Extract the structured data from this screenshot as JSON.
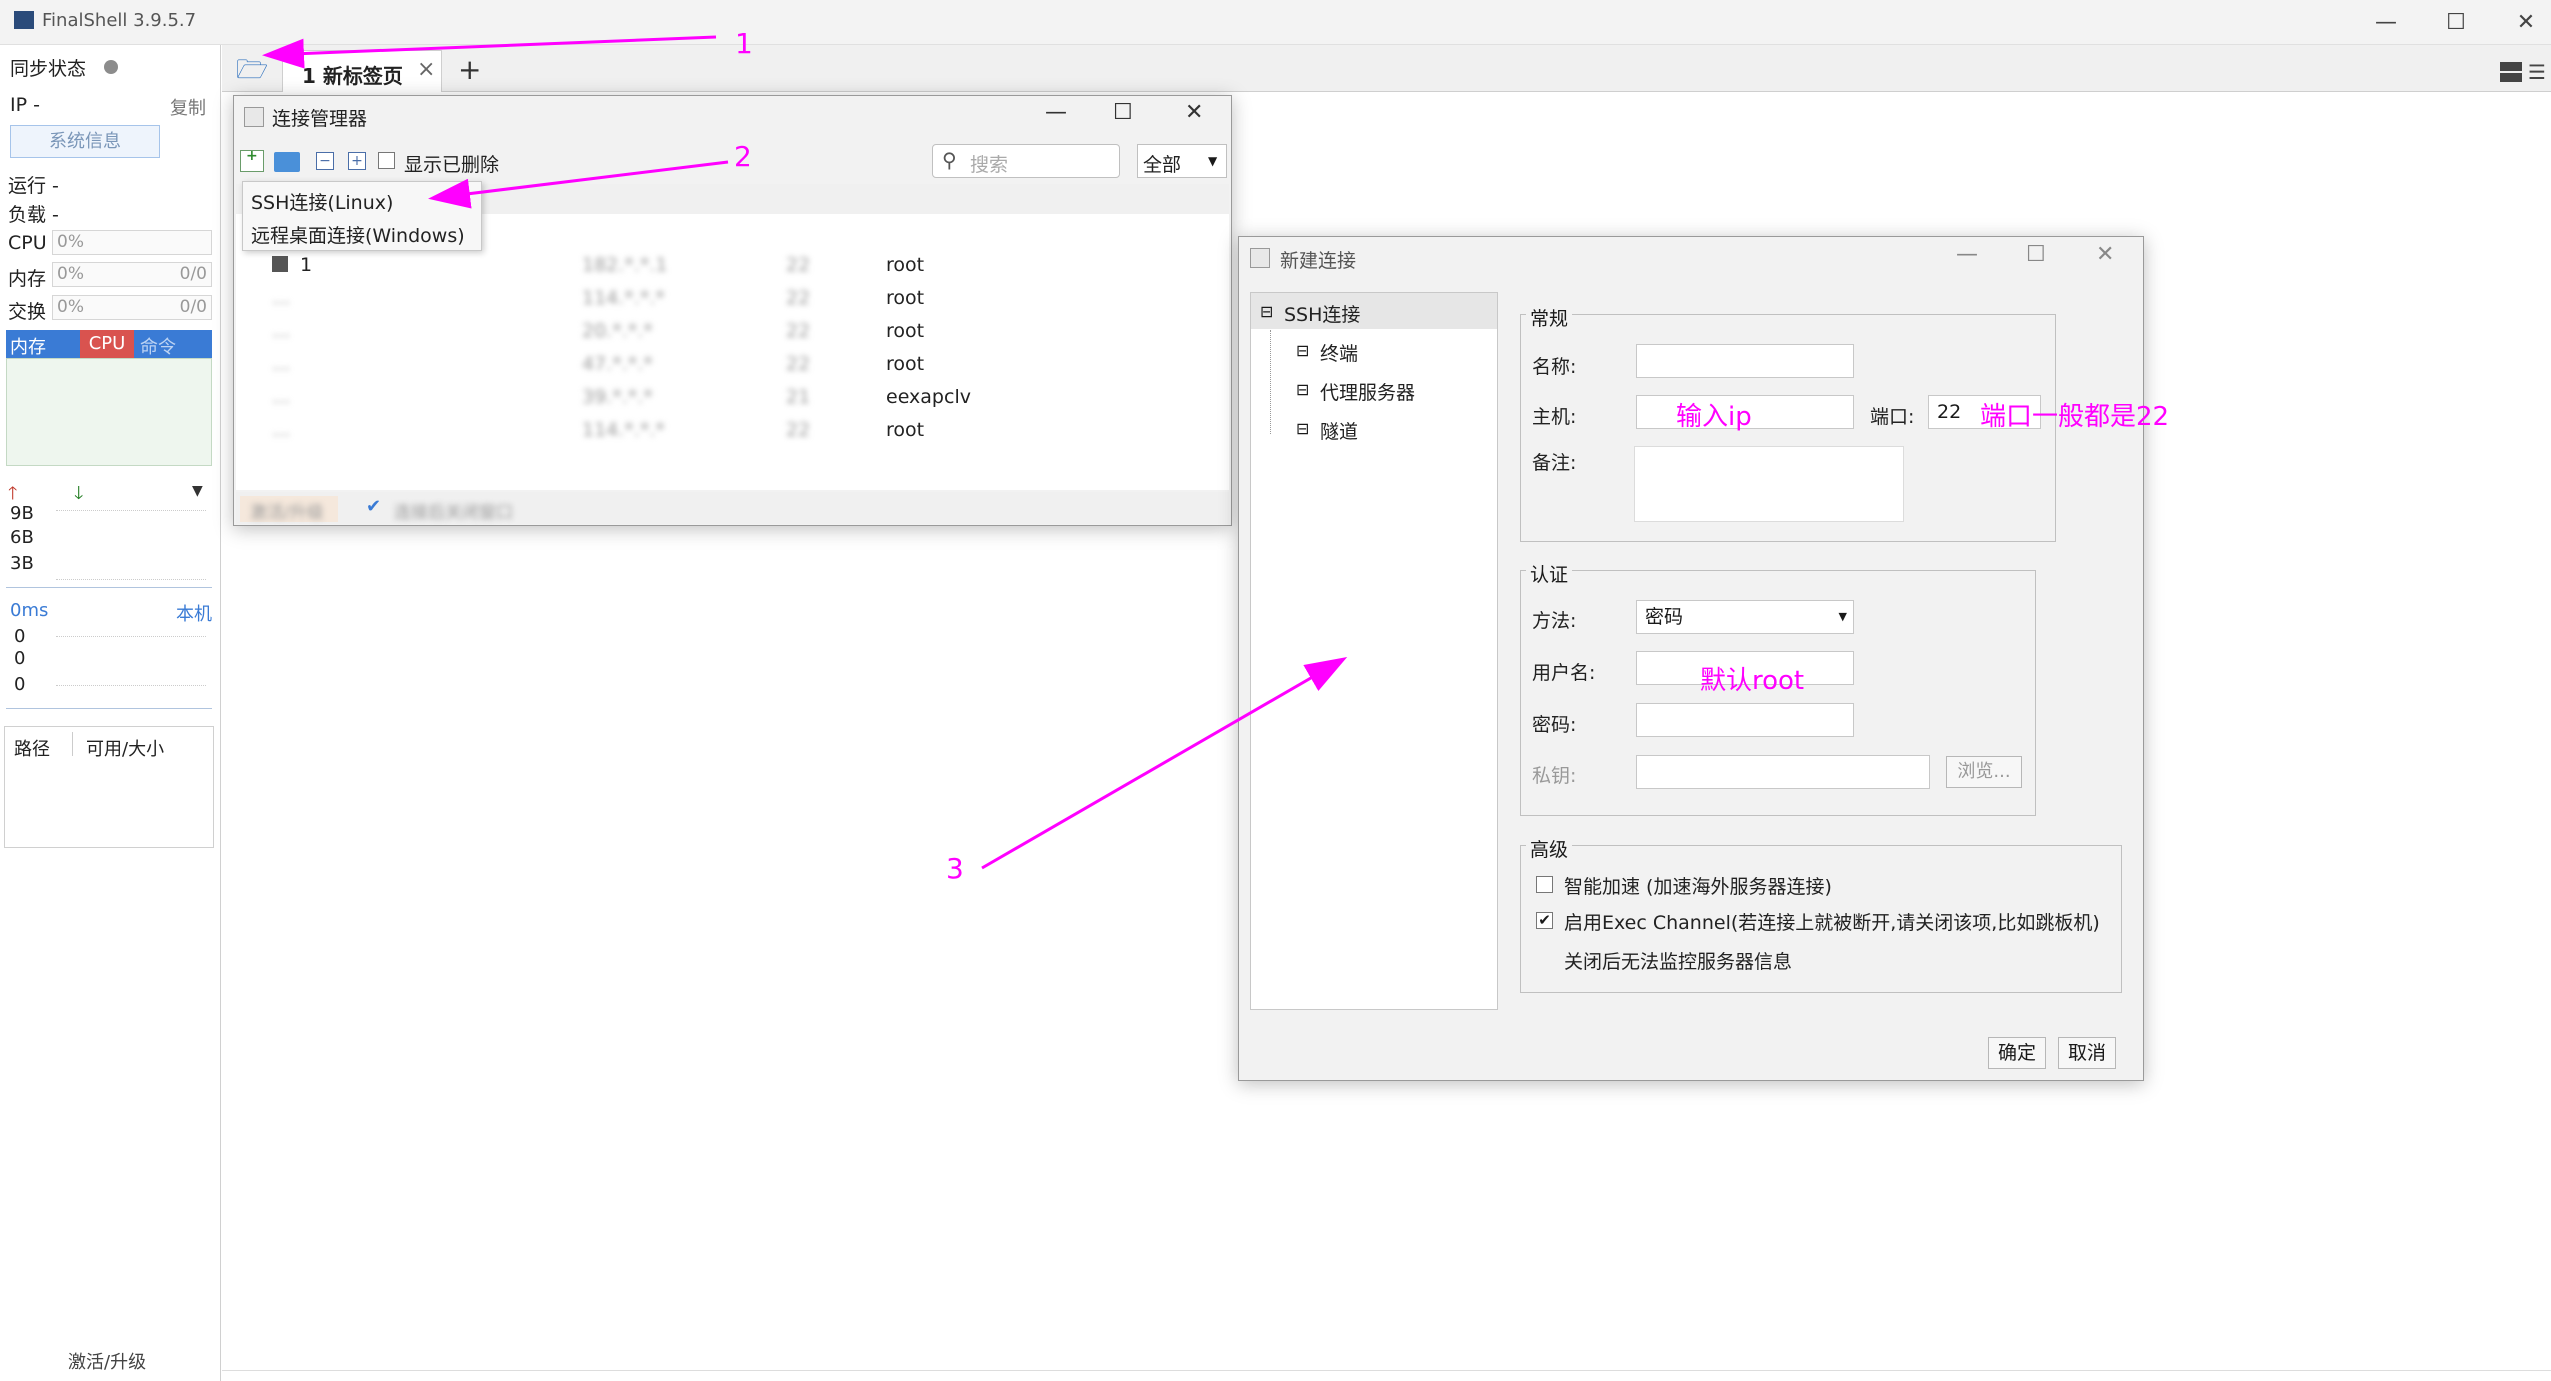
{
  "app": {
    "title": "FinalShell 3.9.5.7"
  },
  "window_controls": {
    "minimize": "—",
    "maximize": "☐",
    "close": "✕"
  },
  "sidebar": {
    "sync_status_label": "同步状态",
    "ip_label": "IP  -",
    "copy_label": "复制",
    "sysinfo_button": "系统信息",
    "running_label": "运行 -",
    "load_label": "负载 -",
    "meters": [
      {
        "label": "CPU",
        "value": "0%",
        "right": ""
      },
      {
        "label": "内存",
        "value": "0%",
        "right": "0/0"
      },
      {
        "label": "交换",
        "value": "0%",
        "right": "0/0"
      }
    ],
    "tabs": [
      "内存",
      "CPU",
      "命令"
    ],
    "net_scale": [
      "9B",
      "6B",
      "3B"
    ],
    "latency_label": "0ms",
    "latency_right": "本机",
    "latency_values": [
      "0",
      "0",
      "0"
    ],
    "disk_columns": [
      "路径",
      "可用/大小"
    ],
    "activate_label": "激活/升级"
  },
  "tabs": {
    "tab1_label": "1 新标签页",
    "tab1_close": "×",
    "add_tab": "+"
  },
  "conn_manager": {
    "title": "连接管理器",
    "show_deleted_label": "显示已删除",
    "search_placeholder": "搜索",
    "filter_value": "全部",
    "menu_items": [
      "SSH连接(Linux)",
      "远程桌面连接(Windows)"
    ],
    "rows": [
      {
        "name": "1",
        "host": "182.*.*.1",
        "port": "22",
        "user": "root"
      },
      {
        "name": "...",
        "host": "114.*.*.*",
        "port": "22",
        "user": "root"
      },
      {
        "name": "...",
        "host": "20.*.*.*",
        "port": "22",
        "user": "root"
      },
      {
        "name": "...",
        "host": "47.*.*.*",
        "port": "22",
        "user": "root"
      },
      {
        "name": "...",
        "host": "39.*.*.*",
        "port": "21",
        "user": "eexapclv"
      },
      {
        "name": "...",
        "host": "114.*.*.*",
        "port": "22",
        "user": "root"
      }
    ],
    "footer_left": "激活/升级",
    "footer_check_label": "连接后关闭窗口"
  },
  "new_conn": {
    "title": "新建连接",
    "tree": {
      "root": "SSH连接",
      "children": [
        "终端",
        "代理服务器",
        "隧道"
      ]
    },
    "general": {
      "legend": "常规",
      "name_label": "名称:",
      "host_label": "主机:",
      "port_label": "端口:",
      "port_value": "22",
      "note_label": "备注:"
    },
    "auth": {
      "legend": "认证",
      "method_label": "方法:",
      "method_value": "密码",
      "username_label": "用户名:",
      "password_label": "密码:",
      "privkey_label": "私钥:",
      "browse_button": "浏览..."
    },
    "advanced": {
      "legend": "高级",
      "smart_accel": "智能加速 (加速海外服务器连接)",
      "exec_channel": "启用Exec Channel(若连接上就被断开,请关闭该项,比如跳板机)",
      "exec_note": "关闭后无法监控服务器信息"
    },
    "ok_button": "确定",
    "cancel_button": "取消"
  },
  "annotations": {
    "n1": "1",
    "n2": "2",
    "n3": "3",
    "host_hint": "输入ip",
    "port_hint": "端口一般都是22",
    "user_hint": "默认root"
  },
  "colors": {
    "annotation": "#ff00ff",
    "tab_active_bg": "#3a7bd5",
    "cpu_tab": "#d9534f"
  }
}
